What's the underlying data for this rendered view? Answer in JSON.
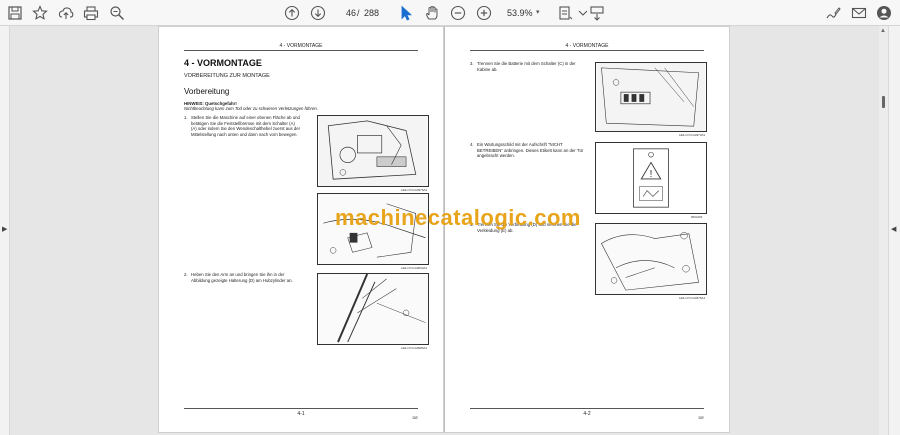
{
  "toolbar": {
    "icons": [
      "save-icon",
      "bookmark-icon",
      "upload-icon",
      "print-icon",
      "zoom-search-icon",
      "page-up-icon",
      "page-down-icon",
      "cursor-icon",
      "hand-icon",
      "zoom-out-icon",
      "zoom-in-icon",
      "fit-page-icon",
      "scroll-mode-icon",
      "sign-icon",
      "mail-icon",
      "account-icon"
    ],
    "current_page": "46",
    "page_separator": "/",
    "total_pages": "288",
    "zoom": "53.9%"
  },
  "left_page": {
    "header": "4 - VORMONTAGE",
    "chapter_title": "4 - VORMONTAGE",
    "chapter_subtitle": "VORBEREITUNG ZUR MONTAGE",
    "section_title": "Vorbereitung",
    "note_title": "HINWEIS: Quetschgefahr!",
    "note_text": "Nichtbeachtung kann zum Tod oder zu schweren Verletzungen führen.",
    "steps": [
      {
        "num": "1.",
        "text": "Stellen Sie die Maschine auf einer ebenen Fläche ab und betätigen Sie die Feststellbremse mit dem Schalter (A) (A) oder indem Sie den Wendeschalthebel zuerst aus der Mittelstellung nach unten und dann nach vorn bewegen."
      },
      {
        "num": "2.",
        "text": "Heben Sie den Arm an und bringen Sie ihn in der Abbildung gezeigte Halterung (D) am Hubzylinder an."
      }
    ],
    "fig_captions": [
      "LEIL17CCA0376A1",
      "LEIL17CCA0004A1",
      "LEIL17CCA0085A1"
    ],
    "footer_page": "4-1",
    "footer_lang": "DE"
  },
  "right_page": {
    "header": "4 - VORMONTAGE",
    "steps": [
      {
        "num": "3.",
        "text": "Trennen Sie die Batterie mit dem Schalter (C) in der Kabine ab."
      },
      {
        "num": "4.",
        "text": "Ein Wartungsschild mit der Aufschrift \"NICHT BETREIBEN\" anbringen. Dieses Etikett kann an der Tür angebracht werden."
      },
      {
        "num": "5.",
        "text": "Trennen Sie die Verbindung (D) und nehmen Sie die Verkleidung (E) ab."
      }
    ],
    "fig_captions": [
      "LEIL17CCA0373A1",
      "RPH003",
      "LEIL17CCA0375A1"
    ],
    "footer_page": "4-2",
    "footer_lang": "DE"
  },
  "watermark": "machinecatalogic.com",
  "colors": {
    "watermark": "#e8a41a",
    "toolbar_bg": "#f7f7f7",
    "cursor_active": "#1a6fd0"
  }
}
